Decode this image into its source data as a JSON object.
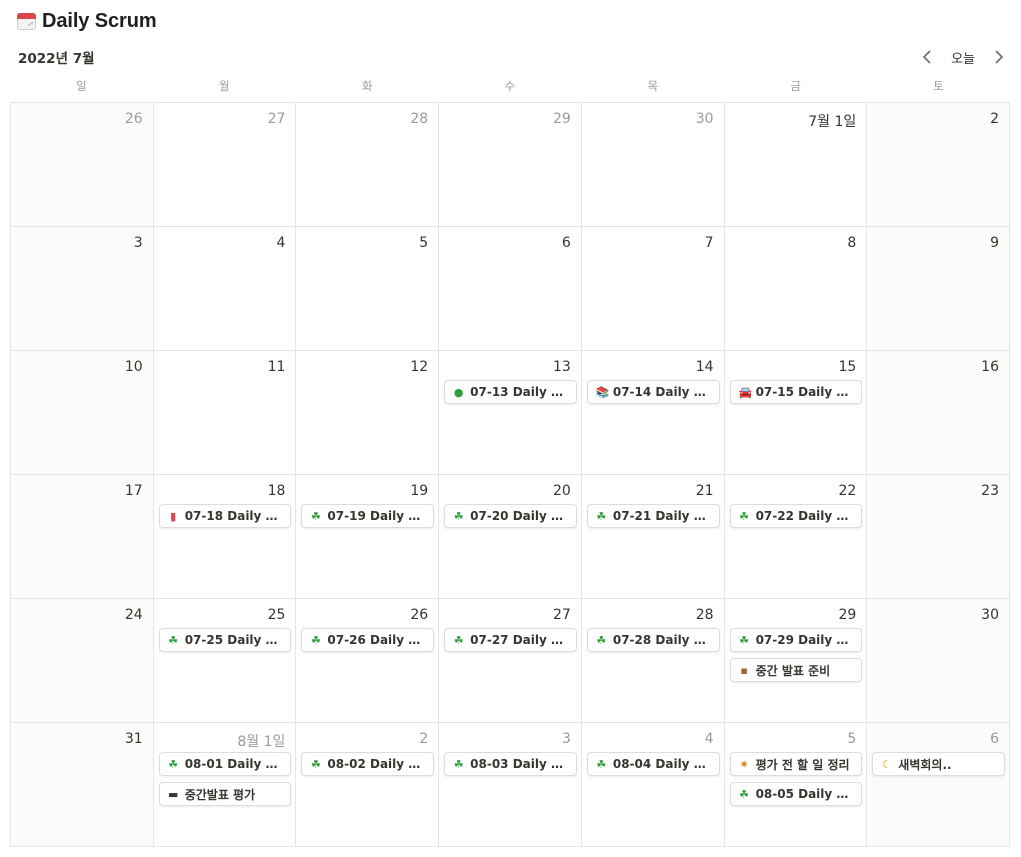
{
  "page": {
    "title": "Daily Scrum",
    "icon": "calendar-icon"
  },
  "header": {
    "month": "2022년 7월",
    "today_label": "오늘",
    "prev_icon": "chevron-left-icon",
    "next_icon": "chevron-right-icon"
  },
  "weekdays": [
    "일",
    "월",
    "화",
    "수",
    "목",
    "금",
    "토"
  ],
  "weeks": [
    [
      {
        "label": "26",
        "other": true
      },
      {
        "label": "27",
        "other": true
      },
      {
        "label": "28",
        "other": true
      },
      {
        "label": "29",
        "other": true
      },
      {
        "label": "30",
        "other": true
      },
      {
        "label": "7월 1일",
        "other": false
      },
      {
        "label": "2",
        "other": false
      }
    ],
    [
      {
        "label": "3",
        "other": false
      },
      {
        "label": "4",
        "other": false
      },
      {
        "label": "5",
        "other": false
      },
      {
        "label": "6",
        "other": false
      },
      {
        "label": "7",
        "other": false
      },
      {
        "label": "8",
        "other": false
      },
      {
        "label": "9",
        "other": false
      }
    ],
    [
      {
        "label": "10",
        "other": false
      },
      {
        "label": "11",
        "other": false
      },
      {
        "label": "12",
        "other": false
      },
      {
        "label": "13",
        "other": false,
        "events": [
          {
            "icon": "green-circle-icon",
            "glyph": "●",
            "color": "#2e9e3a",
            "title": "07-13 Daily Scr..."
          }
        ]
      },
      {
        "label": "14",
        "other": false,
        "events": [
          {
            "icon": "books-icon",
            "glyph": "📚",
            "color": "#c0392b",
            "title": "07-14 Daily Scr..."
          }
        ]
      },
      {
        "label": "15",
        "other": false,
        "events": [
          {
            "icon": "car-icon",
            "glyph": "🚘",
            "color": "#2c3e50",
            "title": "07-15 Daily Scr..."
          }
        ]
      },
      {
        "label": "16",
        "other": false
      }
    ],
    [
      {
        "label": "17",
        "other": false
      },
      {
        "label": "18",
        "other": false,
        "events": [
          {
            "icon": "red-book-icon",
            "glyph": "▮",
            "color": "#d9464b",
            "title": "07-18 Daily Scr..."
          }
        ]
      },
      {
        "label": "19",
        "other": false,
        "events": [
          {
            "icon": "shamrock-icon",
            "glyph": "☘",
            "color": "#2e9e3a",
            "title": "07-19 Daily Scr..."
          }
        ]
      },
      {
        "label": "20",
        "other": false,
        "events": [
          {
            "icon": "shamrock-icon",
            "glyph": "☘",
            "color": "#2e9e3a",
            "title": "07-20 Daily Scr..."
          }
        ]
      },
      {
        "label": "21",
        "other": false,
        "events": [
          {
            "icon": "shamrock-icon",
            "glyph": "☘",
            "color": "#2e9e3a",
            "title": "07-21 Daily Scr..."
          }
        ]
      },
      {
        "label": "22",
        "other": false,
        "events": [
          {
            "icon": "shamrock-icon",
            "glyph": "☘",
            "color": "#2e9e3a",
            "title": "07-22 Daily Scr..."
          }
        ]
      },
      {
        "label": "23",
        "other": false
      }
    ],
    [
      {
        "label": "24",
        "other": false
      },
      {
        "label": "25",
        "other": false,
        "events": [
          {
            "icon": "shamrock-icon",
            "glyph": "☘",
            "color": "#2e9e3a",
            "title": "07-25 Daily Scr..."
          }
        ]
      },
      {
        "label": "26",
        "other": false,
        "events": [
          {
            "icon": "shamrock-icon",
            "glyph": "☘",
            "color": "#2e9e3a",
            "title": "07-26 Daily Scr..."
          }
        ]
      },
      {
        "label": "27",
        "other": false,
        "events": [
          {
            "icon": "shamrock-icon",
            "glyph": "☘",
            "color": "#2e9e3a",
            "title": "07-27 Daily Scr..."
          }
        ]
      },
      {
        "label": "28",
        "other": false,
        "events": [
          {
            "icon": "shamrock-icon",
            "glyph": "☘",
            "color": "#2e9e3a",
            "title": "07-28 Daily Scr..."
          }
        ]
      },
      {
        "label": "29",
        "other": false,
        "events": [
          {
            "icon": "shamrock-icon",
            "glyph": "☘",
            "color": "#2e9e3a",
            "title": "07-29 Daily Scr..."
          },
          {
            "icon": "package-icon",
            "glyph": "▪",
            "color": "#a0652b",
            "title": "중간 발표 준비"
          }
        ]
      },
      {
        "label": "30",
        "other": false
      }
    ],
    [
      {
        "label": "31",
        "other": false
      },
      {
        "label": "8월 1일",
        "other": true,
        "events": [
          {
            "icon": "shamrock-icon",
            "glyph": "☘",
            "color": "#2e9e3a",
            "title": "08-01 Daily Scr..."
          },
          {
            "icon": "sushi-icon",
            "glyph": "▬",
            "color": "#3a3a3a",
            "title": "중간발표 평가"
          }
        ]
      },
      {
        "label": "2",
        "other": true,
        "events": [
          {
            "icon": "shamrock-icon",
            "glyph": "☘",
            "color": "#2e9e3a",
            "title": "08-02 Daily Sc..."
          }
        ]
      },
      {
        "label": "3",
        "other": true,
        "events": [
          {
            "icon": "shamrock-icon",
            "glyph": "☘",
            "color": "#2e9e3a",
            "title": "08-03 Daily Sc..."
          }
        ]
      },
      {
        "label": "4",
        "other": true,
        "events": [
          {
            "icon": "shamrock-icon",
            "glyph": "☘",
            "color": "#2e9e3a",
            "title": "08-04 Daily Sc..."
          }
        ]
      },
      {
        "label": "5",
        "other": true,
        "events": [
          {
            "icon": "party-popper-icon",
            "glyph": "✷",
            "color": "#d98c1e",
            "title": "평가 전 할 일 정리"
          },
          {
            "icon": "shamrock-icon",
            "glyph": "☘",
            "color": "#2e9e3a",
            "title": "08-05 Daily Sc..."
          }
        ]
      },
      {
        "label": "6",
        "other": true,
        "events": [
          {
            "icon": "crescent-moon-icon",
            "glyph": "☾",
            "color": "#e0a800",
            "title": "새벽회의.."
          }
        ]
      }
    ]
  ]
}
